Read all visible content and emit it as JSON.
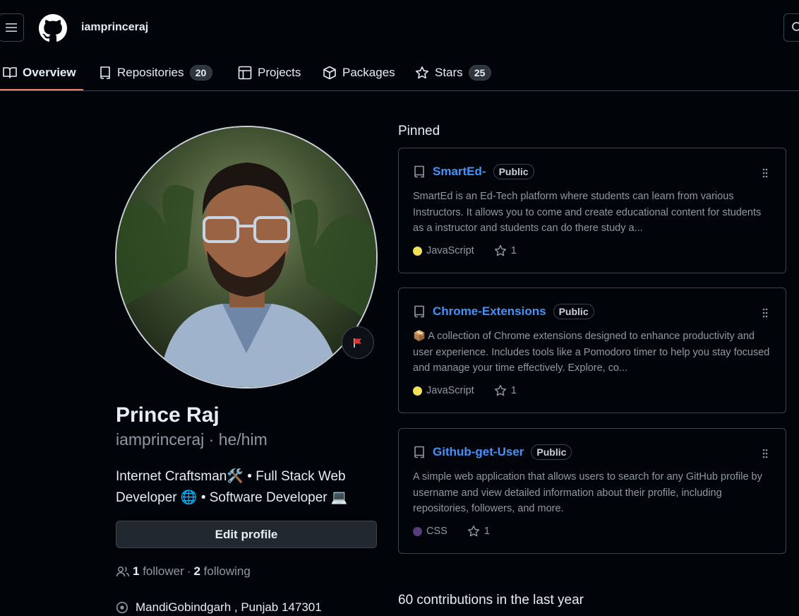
{
  "header": {
    "username": "iamprinceraj"
  },
  "tabs": [
    {
      "label": "Overview",
      "icon": "book-icon",
      "active": true
    },
    {
      "label": "Repositories",
      "icon": "repo-icon",
      "count": "20"
    },
    {
      "label": "Projects",
      "icon": "table-icon"
    },
    {
      "label": "Packages",
      "icon": "package-icon"
    },
    {
      "label": "Stars",
      "icon": "star-icon",
      "count": "25"
    }
  ],
  "profile": {
    "name": "Prince Raj",
    "handle": "iamprinceraj · he/him",
    "bio_line1": "Internet Craftsman🛠️ • Full Stack Web",
    "bio_line2": "Developer 🌐 • Software Developer 💻",
    "edit_label": "Edit profile",
    "followers_count": "1",
    "followers_label": "follower",
    "sep": "·",
    "following_count": "2",
    "following_label": "following",
    "location": "MandiGobindgarh , Punjab 147301"
  },
  "pinned": {
    "title": "Pinned",
    "repos": [
      {
        "name": "SmartEd-",
        "visibility": "Public",
        "description": "SmartEd is an Ed-Tech platform where students can learn from various Instructors. It allows you to come and create educational content for students as a instructor and students can do there study a...",
        "language": "JavaScript",
        "language_color": "#f1e05a",
        "stars": "1"
      },
      {
        "name": "Chrome-Extensions",
        "visibility": "Public",
        "description": "📦 A collection of Chrome extensions designed to enhance productivity and user experience. Includes tools like a Pomodoro timer to help you stay focused and manage your time effectively. Explore, co...",
        "language": "JavaScript",
        "language_color": "#f1e05a",
        "stars": "1"
      },
      {
        "name": "Github-get-User",
        "visibility": "Public",
        "description": "A simple web application that allows users to search for any GitHub profile by username and view detailed information about their profile, including repositories, followers, and more.",
        "language": "CSS",
        "language_color": "#563d7c",
        "stars": "1"
      }
    ]
  },
  "contributions": {
    "title": "60 contributions in the last year"
  }
}
